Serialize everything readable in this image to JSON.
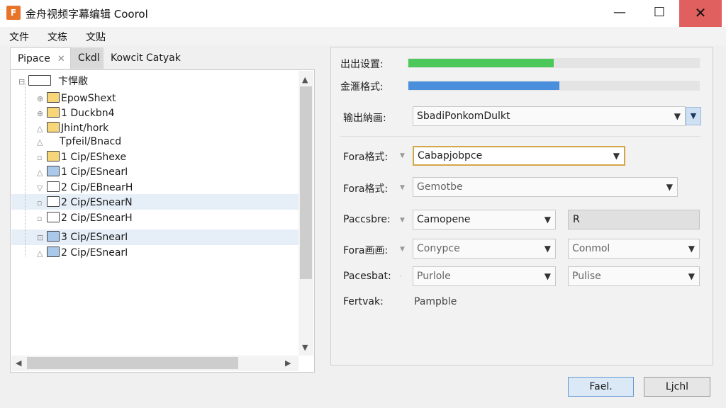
{
  "window": {
    "app_icon": "app-logo-icon",
    "title": "金舟视频字幕编辑 Coorol",
    "minimize": "—",
    "maximize": "☐",
    "close": "✕"
  },
  "menu": [
    "文件",
    "文栋",
    "文贴"
  ],
  "tabs": [
    {
      "label": "Pipace",
      "close": "✕"
    },
    {
      "label": "Ckdl"
    },
    {
      "label": "Kowcit  Catyak"
    }
  ],
  "tree": {
    "root": "卞悍敝",
    "items": [
      {
        "label": "EpowShext",
        "color": "yellow"
      },
      {
        "label": "1 Duckbn4",
        "color": "yellow"
      },
      {
        "label": "Jhint/hork",
        "color": "yellow"
      },
      {
        "label": "Tpfeil/Bnacd",
        "color": "none"
      },
      {
        "label": "1 Cip/EShexe",
        "color": "yellow"
      },
      {
        "label": "1 Cip/ESnearI",
        "color": "blue"
      },
      {
        "label": "2 Cip/EBnearH",
        "color": "white"
      },
      {
        "label": "2 Cip/ESnearN",
        "color": "white",
        "selected": true
      },
      {
        "label": "2 Cip/ESnearH",
        "color": "white"
      },
      {
        "label": "3 Cip/ESnearI",
        "color": "blue",
        "selected": true
      },
      {
        "label": "2 Cip/ESnearI",
        "color": "blue"
      }
    ]
  },
  "settings": {
    "output_label": "出出设置:",
    "output_progress": 0.5,
    "format_label": "金滙格式:",
    "format_progress": 0.52,
    "output_path_label": "输出納画:",
    "output_path_value": "SbadiPonkomDulkt",
    "rows": [
      {
        "label": "Fora格式:",
        "combo": "Cabapjobpce"
      },
      {
        "label": "Fora格式:",
        "combo": "Gemotbe"
      },
      {
        "label": "Paccsbre:",
        "combo": "Camopene",
        "text": "R"
      },
      {
        "label": "Fora画画:",
        "combo": "Conypce",
        "combo2": "Conmol"
      },
      {
        "label": "Pacesbat:",
        "combo": "Purlole",
        "combo2": "Pulise"
      }
    ],
    "footer_label": "Fertvak:",
    "footer_value": "Pampble"
  },
  "buttons": {
    "primary": "Fael.",
    "secondary": "Ljchl"
  },
  "colors": {
    "accent_green": "#4cc85a",
    "accent_blue": "#4a8fdc",
    "close_red": "#e06060",
    "focus_border": "#d4a64a"
  }
}
